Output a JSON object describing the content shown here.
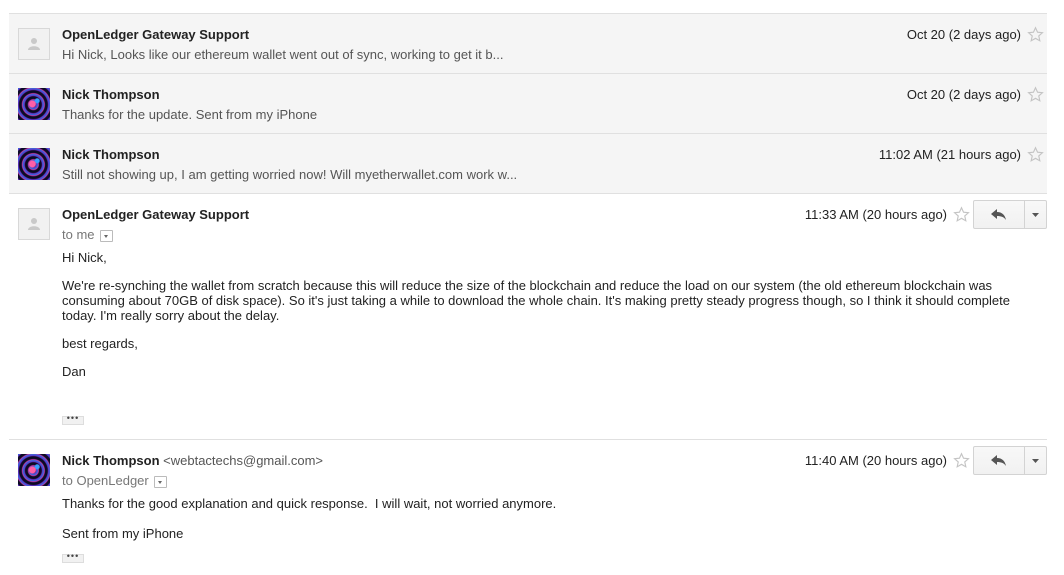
{
  "thread": {
    "collapsed": [
      {
        "sender": "OpenLedger Gateway Support",
        "avatar": "default-person-icon",
        "snippet": "Hi Nick, Looks like our ethereum wallet went out of sync, working to get it b...",
        "date": "Oct 20 (2 days ago)"
      },
      {
        "sender": "Nick Thompson",
        "avatar": "profile-photo",
        "snippet": "Thanks for the update. Sent from my iPhone",
        "date": "Oct 20 (2 days ago)"
      },
      {
        "sender": "Nick Thompson",
        "avatar": "profile-photo",
        "snippet": "Still not showing up, I am getting worried now! Will myetherwallet.com work w...",
        "date": "11:02 AM (21 hours ago)"
      }
    ],
    "expanded": [
      {
        "sender": "OpenLedger Gateway Support",
        "email": "",
        "recipient": "to me",
        "date": "11:33 AM (20 hours ago)",
        "body": [
          "Hi Nick,",
          "We're re-synching the wallet from scratch because this will reduce the size of the blockchain and reduce the load on our system (the old ethereum blockchain was consuming about 70GB of disk space). So it's just taking a while to download the whole chain. It's making pretty steady progress though, so I think it should complete today. I'm really sorry about the delay.",
          "best regards,",
          "Dan"
        ],
        "ellipsis": "•••"
      },
      {
        "sender": "Nick Thompson",
        "email": "<webtactechs@gmail.com>",
        "recipient": "to OpenLedger",
        "date": "11:40 AM (20 hours ago)",
        "body": [
          "Thanks for the good explanation and quick response.  I will wait, not worried anymore.",
          "Sent from my iPhone"
        ],
        "ellipsis": "•••"
      }
    ]
  },
  "icons": {
    "star": "star-outline-icon",
    "reply": "reply-arrow-icon",
    "more": "dropdown-arrow-icon",
    "recipient_toggle": "details-toggle-icon"
  },
  "colors": {
    "collapsed_bg": "#f5f5f5",
    "divider": "#e0e0e0",
    "star": "#c4c4c4"
  }
}
